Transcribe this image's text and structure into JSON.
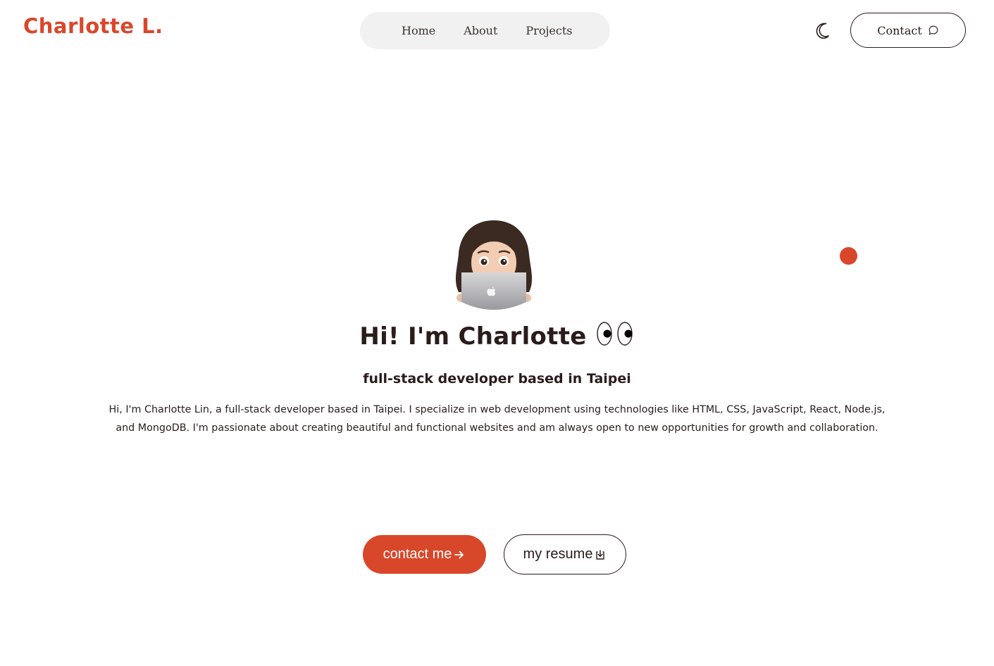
{
  "header": {
    "logo": "Charlotte L.",
    "nav": [
      {
        "label": "Home"
      },
      {
        "label": "About"
      },
      {
        "label": "Projects"
      }
    ],
    "theme_toggle_icon": "moon-icon",
    "contact_label": "Contact",
    "contact_icon": "chat-bubble-icon"
  },
  "hero": {
    "avatar_icon": "memoji-laptop-avatar",
    "title": "Hi! I'm Charlotte",
    "title_icon": "eyes-icon",
    "subtitle": "full-stack developer based in Taipei",
    "bio": "Hi, I'm Charlotte Lin, a full-stack developer based in Taipei. I specialize in web development using technologies like HTML, CSS, JavaScript, React, Node.js, and MongoDB. I'm passionate about creating beautiful and functional websites and am always open to new opportunities for growth and collaboration."
  },
  "cta": {
    "primary_label": "contact me",
    "primary_icon": "arrow-right-icon",
    "secondary_label": "my resume",
    "secondary_icon": "download-icon"
  },
  "colors": {
    "accent": "#d9472b",
    "text": "#2a1c1a",
    "nav_bg": "#f1f1f1"
  }
}
